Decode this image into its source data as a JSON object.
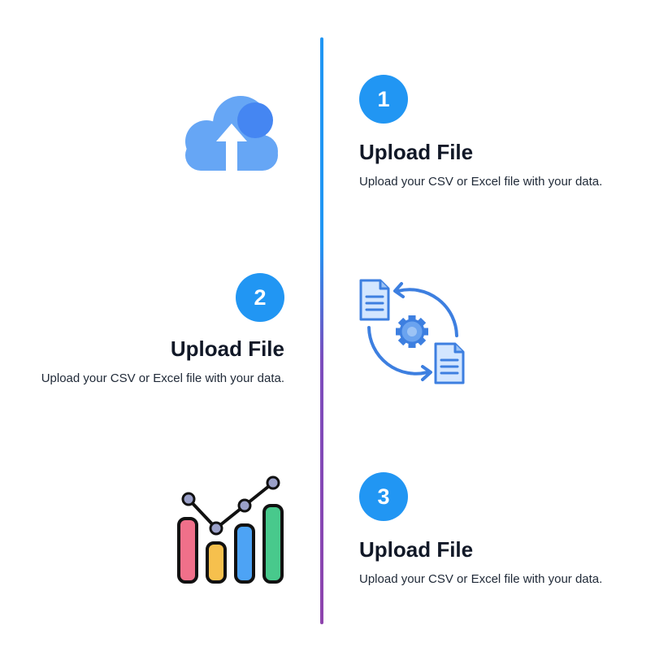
{
  "steps": [
    {
      "number": "1",
      "title": "Upload File",
      "description": "Upload your CSV or Excel file with your data."
    },
    {
      "number": "2",
      "title": "Upload File",
      "description": "Upload your CSV or Excel file with your data."
    },
    {
      "number": "3",
      "title": "Upload File",
      "description": "Upload your CSV or Excel file with your data."
    }
  ],
  "icons": {
    "step1": "cloud-upload-icon",
    "step2": "document-processing-icon",
    "step3": "bar-chart-icon"
  },
  "colors": {
    "accent": "#2196f3",
    "timeline_top": "#2196f3",
    "timeline_bottom": "#8e44ad"
  }
}
